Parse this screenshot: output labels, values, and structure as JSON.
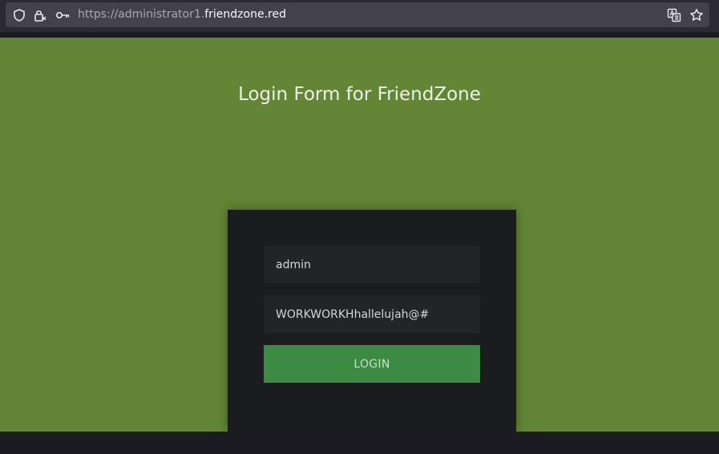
{
  "browser": {
    "url_prefix": "https://administrator1.",
    "url_domain": "friendzone.red",
    "icons": [
      "shield-icon",
      "lock-icon",
      "key-icon",
      "translate-icon",
      "star-icon"
    ]
  },
  "page": {
    "title": "Login Form for FriendZone",
    "background_color": "#638636"
  },
  "login_form": {
    "username_value": "admin",
    "password_value": "WORKWORKHhallelujah@#",
    "login_label": "LOGIN",
    "button_color": "#3b8b43"
  }
}
